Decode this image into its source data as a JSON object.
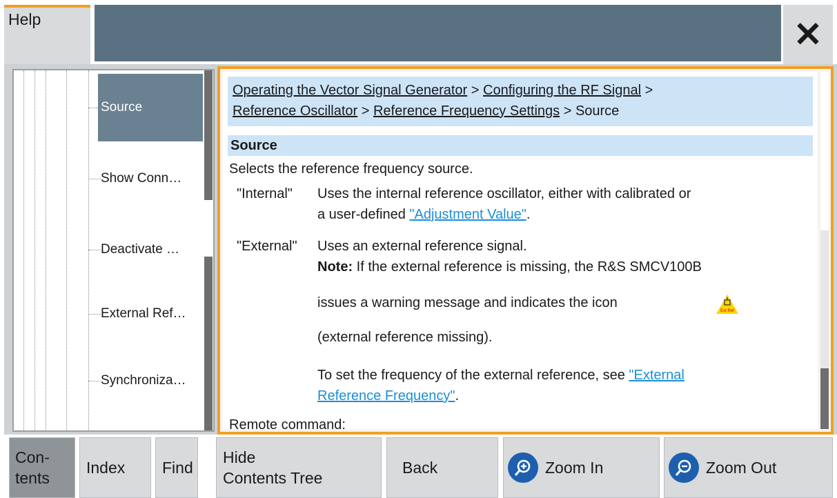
{
  "window": {
    "tab_label": "Help",
    "close_label": "✕"
  },
  "tree": {
    "items": [
      {
        "label": "Source",
        "selected": true
      },
      {
        "label": "Show Conn…",
        "selected": false
      },
      {
        "label": "Deactivate …",
        "selected": false
      },
      {
        "label": "External Ref…",
        "selected": false
      },
      {
        "label": "Synchroniza…",
        "selected": false
      }
    ]
  },
  "help": {
    "breadcrumb": {
      "link1": "Operating the Vector Signal Generator",
      "sep": " > ",
      "link2": "Configuring the RF Signal",
      "link3": "Reference Oscillator",
      "link4": "Reference Frequency Settings",
      "current": "Source"
    },
    "heading": "Source",
    "intro": "Selects the reference frequency source.",
    "internal_key": "\"Internal\"",
    "internal_line1": "Uses the internal reference oscillator, either with calibrated or",
    "internal_line2_prefix": "a user-defined ",
    "internal_link": "\"Adjustment Value\"",
    "internal_line2_suffix": ".",
    "external_key": "\"External\"",
    "external_line1": "Uses an external reference signal.",
    "note_label": "Note:",
    "note_line1": " If the external reference is missing, the R&S SMCV100B",
    "note_line2": "issues a warning message and indicates the icon",
    "note_line3": "(external reference missing).",
    "freq_prefix": "To set the frequency of the external reference, see ",
    "freq_link1": "\"External",
    "freq_link2": "Reference Frequency\"",
    "freq_suffix": ".",
    "remote": "Remote command:",
    "warn_icon_text": "Ext Ref"
  },
  "buttons": {
    "contents": "Con-\ntents",
    "index": "Index",
    "find": "Find",
    "hide_tree": "Hide\nContents Tree",
    "back": "Back",
    "zoom_in": "Zoom In",
    "zoom_out": "Zoom Out"
  },
  "colors": {
    "accent": "#f0a020",
    "title_bar": "#5a7181",
    "selection": "#6a8191",
    "link": "#1a8fd6",
    "zoom_icon": "#1d5fae"
  }
}
